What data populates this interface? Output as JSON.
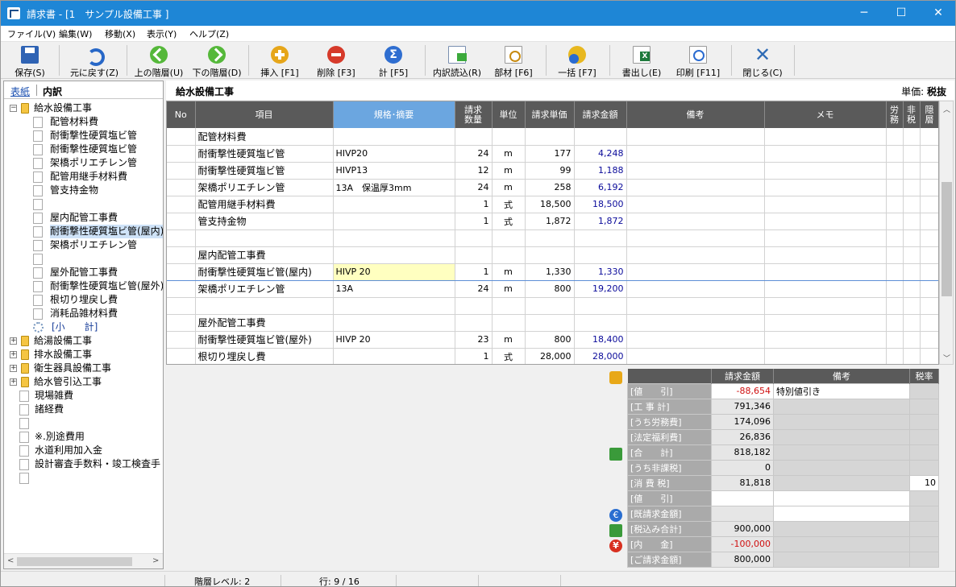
{
  "window": {
    "title": "請求書 - [1　サンプル設備工事 ]",
    "minimize": "─",
    "maximize": "☐",
    "close": "✕"
  },
  "menu": [
    "ファイル(V)",
    "編集(W)",
    "移動(X)",
    "表示(Y)",
    "ヘルプ(Z)"
  ],
  "toolbar": {
    "save": "保存(S)",
    "undo": "元に戻す(Z)",
    "up": "上の階層(U)",
    "down": "下の階層(D)",
    "insert": "挿入 [F1]",
    "delete": "削除 [F3]",
    "sum": "計 [F5]",
    "sigma": "Σ",
    "import": "内訳読込(R)",
    "parts": "部材 [F6]",
    "bulk": "一括 [F7]",
    "export": "書出し(E)",
    "print": "印刷 [F11]",
    "closewin": "閉じる(C)",
    "closeglyph": "✕"
  },
  "left": {
    "tab_cover": "表紙",
    "tab_detail": "内訳",
    "tree": [
      {
        "label": "給水設備工事",
        "kind": "folder",
        "expand": "−",
        "indent": 0
      },
      {
        "label": "配管材料費",
        "kind": "leaf",
        "indent": 1
      },
      {
        "label": "耐衝撃性硬質塩ビ管",
        "kind": "leaf",
        "indent": 1
      },
      {
        "label": "耐衝撃性硬質塩ビ管",
        "kind": "leaf",
        "indent": 1
      },
      {
        "label": "架橋ポリエチレン管",
        "kind": "leaf",
        "indent": 1
      },
      {
        "label": "配管用継手材料費",
        "kind": "leaf",
        "indent": 1
      },
      {
        "label": "管支持金物",
        "kind": "leaf",
        "indent": 1
      },
      {
        "label": "",
        "kind": "leaf",
        "indent": 1
      },
      {
        "label": "屋内配管工事費",
        "kind": "leaf",
        "indent": 1
      },
      {
        "label": "耐衝撃性硬質塩ビ管(屋内)",
        "kind": "leaf",
        "indent": 1,
        "selected": true
      },
      {
        "label": "架橋ポリエチレン管",
        "kind": "leaf",
        "indent": 1
      },
      {
        "label": "",
        "kind": "leaf",
        "indent": 1
      },
      {
        "label": "屋外配管工事費",
        "kind": "leaf",
        "indent": 1
      },
      {
        "label": "耐衝撃性硬質塩ビ管(屋外)",
        "kind": "leaf",
        "indent": 1
      },
      {
        "label": "根切り埋戻し費",
        "kind": "leaf",
        "indent": 1
      },
      {
        "label": "消耗品雑材料費",
        "kind": "leaf",
        "indent": 1
      },
      {
        "label": "[小　　計]",
        "kind": "gear",
        "indent": 1
      },
      {
        "label": "給湯設備工事",
        "kind": "folder",
        "expand": "+",
        "indent": 0
      },
      {
        "label": "排水設備工事",
        "kind": "folder",
        "expand": "+",
        "indent": 0
      },
      {
        "label": "衛生器具設備工事",
        "kind": "folder",
        "expand": "+",
        "indent": 0
      },
      {
        "label": "給水管引込工事",
        "kind": "folder",
        "expand": "+",
        "indent": 0
      },
      {
        "label": "現場雑費",
        "kind": "leaf",
        "indent": 0
      },
      {
        "label": "諸経費",
        "kind": "leaf",
        "indent": 0
      },
      {
        "label": "",
        "kind": "leaf",
        "indent": 0
      },
      {
        "label": "※.別途費用",
        "kind": "leaf",
        "indent": 0
      },
      {
        "label": "水道利用加入金",
        "kind": "leaf",
        "indent": 0
      },
      {
        "label": "設計審査手数料・竣工検査手",
        "kind": "leaf",
        "indent": 0
      },
      {
        "label": "",
        "kind": "leaf",
        "indent": 0
      }
    ]
  },
  "main": {
    "heading": "給水設備工事",
    "unit_label": "単価:",
    "unit_value": "税抜",
    "columns": [
      "No",
      "項目",
      "規格･摘要",
      "請求\n数量",
      "単位",
      "請求単価",
      "請求金額",
      "備考",
      "メモ",
      "労\n務",
      "非\n税",
      "隠\n層"
    ],
    "rows": [
      {
        "no": "",
        "item": "配管材料費",
        "spec": "",
        "qty": "",
        "unit": "",
        "price": "",
        "amount": "",
        "note": "",
        "memo": ""
      },
      {
        "no": "",
        "item": "耐衝撃性硬質塩ビ管",
        "spec": "HIVP20",
        "qty": "24",
        "unit": "m",
        "price": "177",
        "amount": "4,248",
        "note": "",
        "memo": ""
      },
      {
        "no": "",
        "item": "耐衝撃性硬質塩ビ管",
        "spec": "HIVP13",
        "qty": "12",
        "unit": "m",
        "price": "99",
        "amount": "1,188",
        "note": "",
        "memo": ""
      },
      {
        "no": "",
        "item": "架橋ポリエチレン管",
        "spec": "13A　保温厚3mm",
        "qty": "24",
        "unit": "m",
        "price": "258",
        "amount": "6,192",
        "note": "",
        "memo": ""
      },
      {
        "no": "",
        "item": "配管用継手材料費",
        "spec": "",
        "qty": "1",
        "unit": "式",
        "price": "18,500",
        "amount": "18,500",
        "note": "",
        "memo": ""
      },
      {
        "no": "",
        "item": "管支持金物",
        "spec": "",
        "qty": "1",
        "unit": "式",
        "price": "1,872",
        "amount": "1,872",
        "note": "",
        "memo": ""
      },
      {
        "no": "",
        "item": "",
        "spec": "",
        "qty": "",
        "unit": "",
        "price": "",
        "amount": "",
        "note": "",
        "memo": ""
      },
      {
        "no": "",
        "item": "屋内配管工事費",
        "spec": "",
        "qty": "",
        "unit": "",
        "price": "",
        "amount": "",
        "note": "",
        "memo": ""
      },
      {
        "no": "",
        "item": "耐衝撃性硬質塩ビ管(屋内)",
        "spec": "HIVP 20",
        "qty": "1",
        "unit": "m",
        "price": "1,330",
        "amount": "1,330",
        "note": "",
        "memo": "",
        "current": true
      },
      {
        "no": "",
        "item": "架橋ポリエチレン管",
        "spec": "13A",
        "qty": "24",
        "unit": "m",
        "price": "800",
        "amount": "19,200",
        "note": "",
        "memo": ""
      },
      {
        "no": "",
        "item": "",
        "spec": "",
        "qty": "",
        "unit": "",
        "price": "",
        "amount": "",
        "note": "",
        "memo": ""
      },
      {
        "no": "",
        "item": "屋外配管工事費",
        "spec": "",
        "qty": "",
        "unit": "",
        "price": "",
        "amount": "",
        "note": "",
        "memo": ""
      },
      {
        "no": "",
        "item": "耐衝撃性硬質塩ビ管(屋外)",
        "spec": "HIVP 20",
        "qty": "23",
        "unit": "m",
        "price": "800",
        "amount": "18,400",
        "note": "",
        "memo": ""
      },
      {
        "no": "",
        "item": "根切り埋戻し費",
        "spec": "",
        "qty": "1",
        "unit": "式",
        "price": "28,000",
        "amount": "28,000",
        "note": "",
        "memo": ""
      }
    ]
  },
  "summary": {
    "col_amount": "請求金額",
    "col_note": "備考",
    "col_tax": "税率",
    "rows": [
      {
        "label": "[値　　引]",
        "amount": "-88,654",
        "note": "特別値引き",
        "tax": "",
        "neg": true,
        "editable": true
      },
      {
        "label": "[工 事 計]",
        "amount": "791,346",
        "note": "",
        "tax": ""
      },
      {
        "label": "[うち労務費]",
        "amount": "174,096",
        "note": "",
        "tax": ""
      },
      {
        "label": "[法定福利費]",
        "amount": "26,836",
        "note": "",
        "tax": ""
      },
      {
        "label": "[合　　計]",
        "amount": "818,182",
        "note": "",
        "tax": ""
      },
      {
        "label": "[うち非課税]",
        "amount": "0",
        "note": "",
        "tax": ""
      },
      {
        "label": "[消 費 税]",
        "amount": "81,818",
        "note": "",
        "tax": "10",
        "taxedit": true
      },
      {
        "label": "[値　　引]",
        "amount": "",
        "note": "",
        "tax": "",
        "editable": true
      },
      {
        "label": "[既請求金額]",
        "amount": "",
        "note": "",
        "tax": "",
        "noteedit": true
      },
      {
        "label": "[税込み合計]",
        "amount": "900,000",
        "note": "",
        "tax": ""
      },
      {
        "label": "[内　　金]",
        "amount": "-100,000",
        "note": "",
        "tax": "",
        "neg": true
      },
      {
        "label": "[ご請求金額]",
        "amount": "800,000",
        "note": "",
        "tax": ""
      }
    ],
    "euro": "€",
    "yen": "¥"
  },
  "status": {
    "level": "階層レベル: 2",
    "line": "行: 9 / 16"
  },
  "colors": {
    "titlebar": "#1e86d6",
    "header": "#5a5a5a",
    "selected_header": "#6ba6e0",
    "amount_text": "#0a0a9a",
    "negative": "#d01010"
  }
}
